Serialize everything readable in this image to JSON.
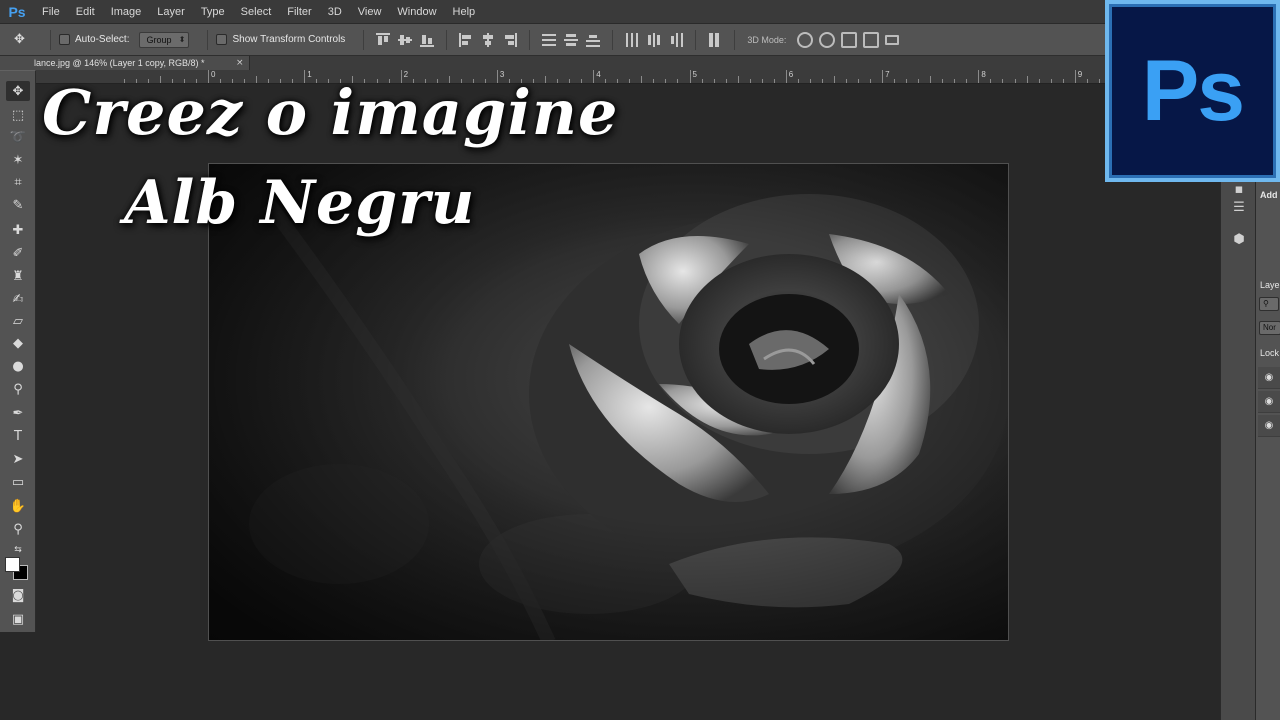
{
  "app": {
    "logo_small": "Ps",
    "logo_large": "Ps"
  },
  "menu": [
    "File",
    "Edit",
    "Image",
    "Layer",
    "Type",
    "Select",
    "Filter",
    "3D",
    "View",
    "Window",
    "Help"
  ],
  "options": {
    "auto_select_label": "Auto-Select:",
    "auto_select_value": "Group",
    "show_transform_label": "Show Transform Controls",
    "mode3d_label": "3D Mode:"
  },
  "document": {
    "tab_title": "lance.jpg @ 146% (Layer 1 copy, RGB/8) *",
    "close_glyph": "×"
  },
  "ruler": {
    "labels": [
      "0",
      "1",
      "2",
      "3",
      "4",
      "5",
      "6",
      "7",
      "8",
      "9"
    ]
  },
  "title_overlay": {
    "line1": "Creez o imagine",
    "line2": "Alb Negru"
  },
  "panel": {
    "adjust_label": "Add",
    "layers_label": "Laye",
    "blend_value": "Nor",
    "lock_label": "Lock"
  },
  "colors": {
    "ps_blue": "#3aa0f4",
    "ps_dark": "#061747",
    "ps_frame": "#6fb8ee"
  }
}
